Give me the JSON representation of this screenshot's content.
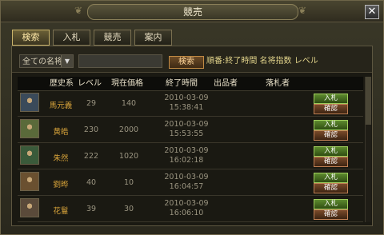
{
  "window": {
    "title": "競売",
    "close_label": "✕"
  },
  "tabs": [
    "検索",
    "入札",
    "競売",
    "案内"
  ],
  "search": {
    "category": "全ての名将",
    "button_label": "検索",
    "sort_text": "順番:終了時間 名将指数 レベル"
  },
  "table": {
    "headers": [
      "",
      "歴史系",
      "レベル",
      "現在価格",
      "終了時間",
      "出品者",
      "落札者",
      ""
    ],
    "rows": [
      {
        "name": "馬元義",
        "level": "29",
        "price": "140",
        "date": "2010-03-09",
        "time": "15:38:41",
        "seller": "",
        "bidder": "",
        "avatar_color": "#3a4a5a",
        "bid_label": "入札",
        "confirm_label": "確認"
      },
      {
        "name": "黄皓",
        "level": "230",
        "price": "2000",
        "date": "2010-03-09",
        "time": "15:53:55",
        "seller": "",
        "bidder": "",
        "avatar_color": "#5a6a3a",
        "bid_label": "入札",
        "confirm_label": "確認"
      },
      {
        "name": "朱然",
        "level": "222",
        "price": "1020",
        "date": "2010-03-09",
        "time": "16:02:18",
        "seller": "",
        "bidder": "",
        "avatar_color": "#3a5a3a",
        "bid_label": "入札",
        "confirm_label": "確認"
      },
      {
        "name": "劉晔",
        "level": "40",
        "price": "10",
        "date": "2010-03-09",
        "time": "16:04:57",
        "seller": "",
        "bidder": "",
        "avatar_color": "#6a5030",
        "bid_label": "入札",
        "confirm_label": "確認"
      },
      {
        "name": "花鬘",
        "level": "39",
        "price": "30",
        "date": "2010-03-09",
        "time": "16:06:10",
        "seller": "",
        "bidder": "",
        "avatar_color": "#5a4a3a",
        "bid_label": "入札",
        "confirm_label": "確認"
      }
    ]
  }
}
